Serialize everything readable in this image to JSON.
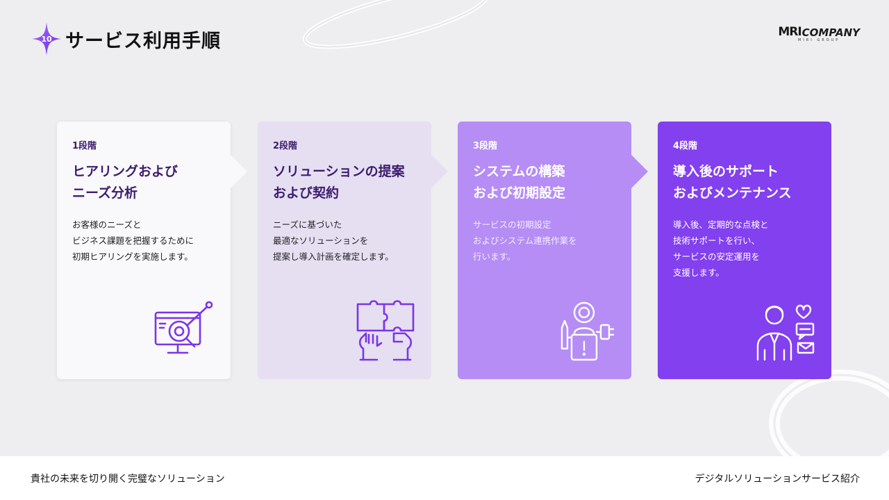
{
  "header": {
    "step_number": "10",
    "title": "サービス利用手順"
  },
  "logo": {
    "mark": "MRI",
    "name": "COMPANY",
    "group": "MIRI GROUP"
  },
  "cards": [
    {
      "stage": "1段階",
      "heading": "ヒアリングおよび\nニーズ分析",
      "description": "お客様のニーズと\nビジネス課題を把握するために\n初期ヒアリングを実施します。",
      "icon": "monitor-magnifier-icon"
    },
    {
      "stage": "2段階",
      "heading": "ソリューションの提案\nおよび契約",
      "description": "ニーズに基づいた\n最適なソリューションを\n提案し導入計画を確定します。",
      "icon": "puzzle-hands-icon"
    },
    {
      "stage": "3段階",
      "heading": "システムの構築\nおよび初期設定",
      "description": "サービスの初期設定\nおよびシステム連携作業を\n行います。",
      "icon": "engineer-setup-icon"
    },
    {
      "stage": "4段階",
      "heading": "導入後のサポート\nおよびメンテナンス",
      "description": "導入後、定期的な点検と\n技術サポートを行い、\nサービスの安定運用を\n支援します。",
      "icon": "support-agent-icon"
    }
  ],
  "footer": {
    "left_text": "貴社の未来を切り開く完璧なソリューション",
    "right_text": "デジタルソリューションサービス紹介"
  },
  "colors": {
    "accent_purple": "#8340ef",
    "light_purple": "#b58df5",
    "lavender": "#e6dff2",
    "dark_purple_text": "#3b1c6e"
  }
}
